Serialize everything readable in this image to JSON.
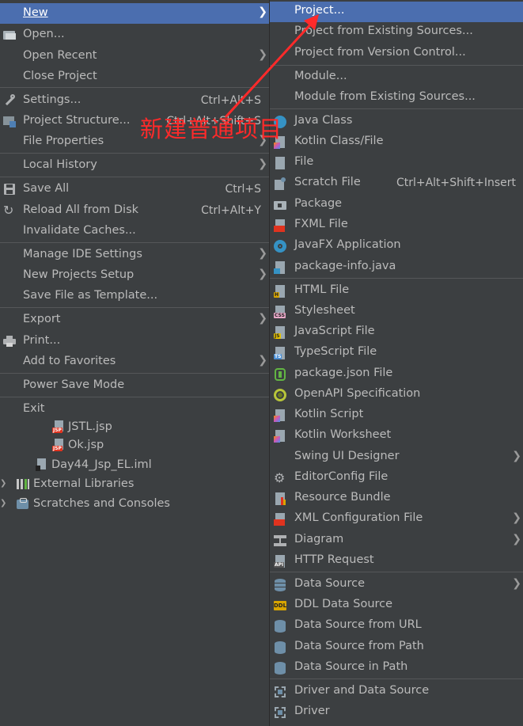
{
  "file_menu": {
    "items": [
      {
        "label": "New",
        "submenu": true
      },
      {
        "label": "Open..."
      },
      {
        "label": "Open Recent",
        "submenu": true
      },
      {
        "label": "Close Project"
      },
      {
        "label": "Settings...",
        "shortcut": "Ctrl+Alt+S"
      },
      {
        "label": "Project Structure...",
        "shortcut": "Ctrl+Alt+Shift+S"
      },
      {
        "label": "File Properties",
        "submenu": true
      },
      {
        "label": "Local History",
        "submenu": true
      },
      {
        "label": "Save All",
        "shortcut": "Ctrl+S"
      },
      {
        "label": "Reload All from Disk",
        "shortcut": "Ctrl+Alt+Y"
      },
      {
        "label": "Invalidate Caches..."
      },
      {
        "label": "Manage IDE Settings",
        "submenu": true
      },
      {
        "label": "New Projects Setup",
        "submenu": true
      },
      {
        "label": "Save File as Template..."
      },
      {
        "label": "Export",
        "submenu": true
      },
      {
        "label": "Print..."
      },
      {
        "label": "Add to Favorites",
        "submenu": true
      },
      {
        "label": "Power Save Mode"
      },
      {
        "label": "Exit"
      }
    ]
  },
  "new_menu": {
    "items": [
      {
        "label": "Project..."
      },
      {
        "label": "Project from Existing Sources..."
      },
      {
        "label": "Project from Version Control..."
      },
      {
        "label": "Module..."
      },
      {
        "label": "Module from Existing Sources..."
      },
      {
        "label": "Java Class"
      },
      {
        "label": "Kotlin Class/File"
      },
      {
        "label": "File"
      },
      {
        "label": "Scratch File",
        "shortcut": "Ctrl+Alt+Shift+Insert"
      },
      {
        "label": "Package"
      },
      {
        "label": "FXML File"
      },
      {
        "label": "JavaFX Application"
      },
      {
        "label": "package-info.java"
      },
      {
        "label": "HTML File"
      },
      {
        "label": "Stylesheet"
      },
      {
        "label": "JavaScript File"
      },
      {
        "label": "TypeScript File"
      },
      {
        "label": "package.json File"
      },
      {
        "label": "OpenAPI Specification"
      },
      {
        "label": "Kotlin Script"
      },
      {
        "label": "Kotlin Worksheet"
      },
      {
        "label": "Swing UI Designer",
        "submenu": true
      },
      {
        "label": "EditorConfig File"
      },
      {
        "label": "Resource Bundle"
      },
      {
        "label": "XML Configuration File",
        "submenu": true
      },
      {
        "label": "Diagram",
        "submenu": true
      },
      {
        "label": "HTTP Request"
      },
      {
        "label": "Data Source",
        "submenu": true
      },
      {
        "label": "DDL Data Source"
      },
      {
        "label": "Data Source from URL"
      },
      {
        "label": "Data Source from Path"
      },
      {
        "label": "Data Source in Path"
      },
      {
        "label": "Driver and Data Source"
      },
      {
        "label": "Driver"
      }
    ]
  },
  "project_tree": {
    "items": [
      {
        "label": "JSTL.jsp"
      },
      {
        "label": "Ok.jsp"
      },
      {
        "label": "Day44_Jsp_EL.iml"
      },
      {
        "label": "External Libraries"
      },
      {
        "label": "Scratches and Consoles"
      }
    ]
  },
  "annotation": {
    "text": "新建普通项目",
    "color": "#ff2a2a"
  },
  "colors": {
    "menu_bg": "#3c3f41",
    "selection": "#4b6eaf",
    "text": "#bbbbbb"
  }
}
